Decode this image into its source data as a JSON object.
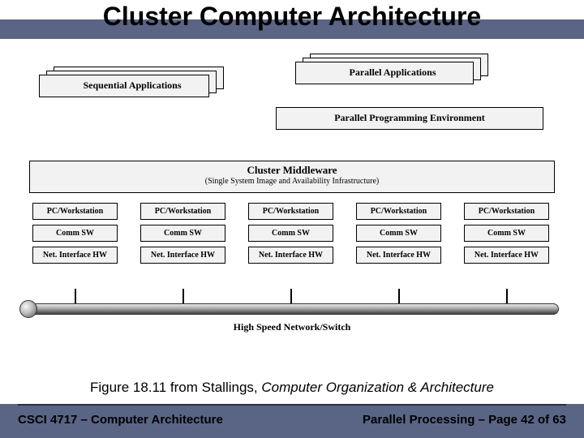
{
  "title": "Cluster Computer Architecture",
  "top_left_block": {
    "label": "Sequential Applications"
  },
  "top_right_block": {
    "label": "Parallel Applications"
  },
  "env_block": {
    "label": "Parallel Programming Environment"
  },
  "middleware": {
    "title": "Cluster Middleware",
    "subtitle": "(Single System Image and Availability Infrastructure)"
  },
  "node_labels": {
    "pc": "PC/Workstation",
    "comm": "Comm SW",
    "net": "Net. Interface HW"
  },
  "network_label": "High Speed Network/Switch",
  "caption": {
    "prefix": "Figure 18.11 from Stallings, ",
    "book": "Computer Organization & Architecture"
  },
  "footer": {
    "left": "CSCI 4717 – Computer Architecture",
    "right": "Parallel Processing – Page 42 of 63"
  }
}
